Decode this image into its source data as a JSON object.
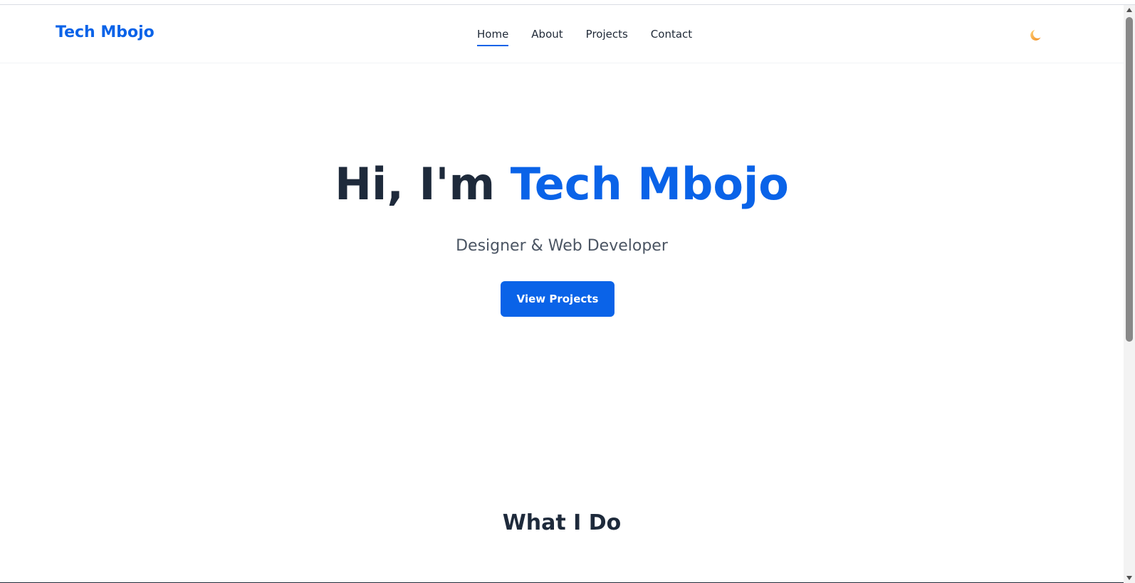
{
  "header": {
    "brand": "Tech Mbojo",
    "nav": [
      {
        "label": "Home",
        "active": true
      },
      {
        "label": "About",
        "active": false
      },
      {
        "label": "Projects",
        "active": false
      },
      {
        "label": "Contact",
        "active": false
      }
    ],
    "theme_toggle_icon": "moon-icon"
  },
  "hero": {
    "title_prefix": "Hi, I'm",
    "title_name": "Tech Mbojo",
    "subtitle": "Designer & Web Developer",
    "cta_label": "View Projects"
  },
  "sections": {
    "what_i_do_title": "What I Do"
  },
  "colors": {
    "accent": "#0a63e8",
    "heading": "#1e2a3b",
    "subtitle": "#4b5563",
    "moon": "#f5a623"
  }
}
